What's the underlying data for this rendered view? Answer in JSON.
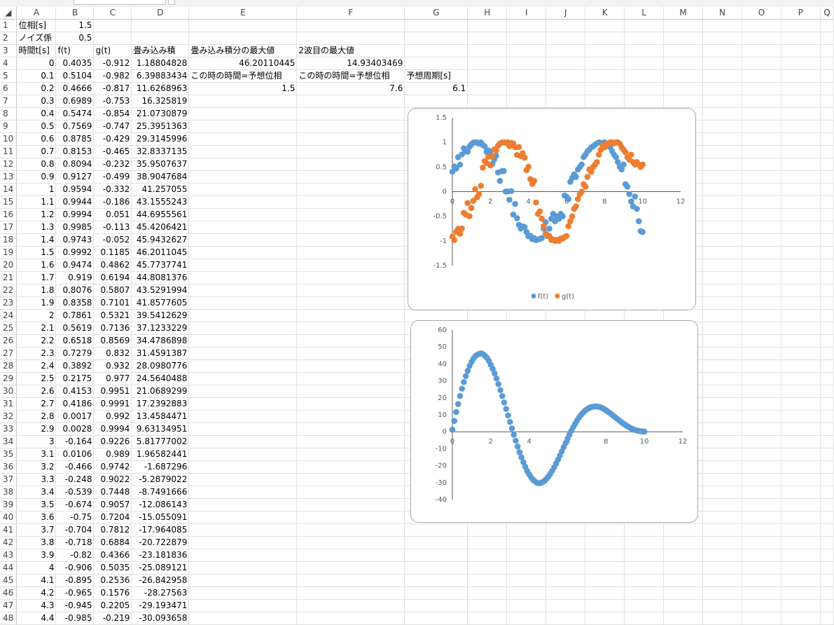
{
  "columns": [
    "A",
    "B",
    "C",
    "D",
    "E",
    "F",
    "G",
    "H",
    "I",
    "J",
    "K",
    "L",
    "M",
    "N",
    "O",
    "P",
    "Q"
  ],
  "rows": [
    {
      "r": "1",
      "A": "位相[s]",
      "B": "1.5"
    },
    {
      "r": "2",
      "A": "ノイズ係",
      "B": "0.5"
    },
    {
      "r": "3",
      "A": "時間t[s]",
      "B": "f(t)",
      "C": "g(t)",
      "D": "畳み込み積",
      "E": "畳み込み積分の最大値",
      "F": "2波目の最大値"
    },
    {
      "r": "4",
      "A": "0",
      "B": "0.4035",
      "C": "-0.912",
      "D": "1.18804828",
      "E": "46.20110445",
      "F": "14.93403469"
    },
    {
      "r": "5",
      "A": "0.1",
      "B": "0.5104",
      "C": "-0.982",
      "D": "6.39883434",
      "E": "この時の時間=予想位相",
      "F": "この時の時間=予想位相",
      "G": "予想周期[s]"
    },
    {
      "r": "6",
      "A": "0.2",
      "B": "0.4666",
      "C": "-0.817",
      "D": "11.6268963",
      "E": "1.5",
      "F": "7.6",
      "G": "6.1"
    },
    {
      "r": "7",
      "A": "0.3",
      "B": "0.6989",
      "C": "-0.753",
      "D": "16.325819"
    },
    {
      "r": "8",
      "A": "0.4",
      "B": "0.5474",
      "C": "-0.854",
      "D": "21.0730879"
    },
    {
      "r": "9",
      "A": "0.5",
      "B": "0.7569",
      "C": "-0.747",
      "D": "25.3951363"
    },
    {
      "r": "10",
      "A": "0.6",
      "B": "0.8785",
      "C": "-0.429",
      "D": "29.3145996"
    },
    {
      "r": "11",
      "A": "0.7",
      "B": "0.8153",
      "C": "-0.465",
      "D": "32.8337135"
    },
    {
      "r": "12",
      "A": "0.8",
      "B": "0.8094",
      "C": "-0.232",
      "D": "35.9507637"
    },
    {
      "r": "13",
      "A": "0.9",
      "B": "0.9127",
      "C": "-0.499",
      "D": "38.9047684"
    },
    {
      "r": "14",
      "A": "1",
      "B": "0.9594",
      "C": "-0.332",
      "D": "41.257055"
    },
    {
      "r": "15",
      "A": "1.1",
      "B": "0.9944",
      "C": "-0.186",
      "D": "43.1555243"
    },
    {
      "r": "16",
      "A": "1.2",
      "B": "0.9994",
      "C": "0.051",
      "D": "44.6955561"
    },
    {
      "r": "17",
      "A": "1.3",
      "B": "0.9985",
      "C": "-0.113",
      "D": "45.4206421"
    },
    {
      "r": "18",
      "A": "1.4",
      "B": "0.9743",
      "C": "-0.052",
      "D": "45.9432627"
    },
    {
      "r": "19",
      "A": "1.5",
      "B": "0.9992",
      "C": "0.1185",
      "D": "46.2011045"
    },
    {
      "r": "20",
      "A": "1.6",
      "B": "0.9474",
      "C": "0.4862",
      "D": "45.7737741"
    },
    {
      "r": "21",
      "A": "1.7",
      "B": "0.919",
      "C": "0.6194",
      "D": "44.8081376"
    },
    {
      "r": "22",
      "A": "1.8",
      "B": "0.8076",
      "C": "0.5807",
      "D": "43.5291994"
    },
    {
      "r": "23",
      "A": "1.9",
      "B": "0.8358",
      "C": "0.7101",
      "D": "41.8577605"
    },
    {
      "r": "24",
      "A": "2",
      "B": "0.7861",
      "C": "0.5321",
      "D": "39.5412629"
    },
    {
      "r": "25",
      "A": "2.1",
      "B": "0.5619",
      "C": "0.7136",
      "D": "37.1233229"
    },
    {
      "r": "26",
      "A": "2.2",
      "B": "0.6518",
      "C": "0.8569",
      "D": "34.4786898"
    },
    {
      "r": "27",
      "A": "2.3",
      "B": "0.7279",
      "C": "0.832",
      "D": "31.4591387"
    },
    {
      "r": "28",
      "A": "2.4",
      "B": "0.3892",
      "C": "0.932",
      "D": "28.0980776"
    },
    {
      "r": "29",
      "A": "2.5",
      "B": "0.2175",
      "C": "0.977",
      "D": "24.5640488"
    },
    {
      "r": "30",
      "A": "2.6",
      "B": "0.4153",
      "C": "0.9951",
      "D": "21.0689299"
    },
    {
      "r": "31",
      "A": "2.7",
      "B": "0.4186",
      "C": "0.9991",
      "D": "17.2392883"
    },
    {
      "r": "32",
      "A": "2.8",
      "B": "0.0017",
      "C": "0.992",
      "D": "13.4584471"
    },
    {
      "r": "33",
      "A": "2.9",
      "B": "0.0028",
      "C": "0.9994",
      "D": "9.63134951"
    },
    {
      "r": "34",
      "A": "3",
      "B": "-0.164",
      "C": "0.9226",
      "D": "5.81777002"
    },
    {
      "r": "35",
      "A": "3.1",
      "B": "0.0106",
      "C": "0.989",
      "D": "1.96582441"
    },
    {
      "r": "36",
      "A": "3.2",
      "B": "-0.466",
      "C": "0.9742",
      "D": "-1.687296"
    },
    {
      "r": "37",
      "A": "3.3",
      "B": "-0.248",
      "C": "0.9022",
      "D": "-5.2879022"
    },
    {
      "r": "38",
      "A": "3.4",
      "B": "-0.539",
      "C": "0.7448",
      "D": "-8.7491666"
    },
    {
      "r": "39",
      "A": "3.5",
      "B": "-0.674",
      "C": "0.9057",
      "D": "-12.086143"
    },
    {
      "r": "40",
      "A": "3.6",
      "B": "-0.75",
      "C": "0.7204",
      "D": "-15.055091"
    },
    {
      "r": "41",
      "A": "3.7",
      "B": "-0.704",
      "C": "0.7812",
      "D": "-17.964085"
    },
    {
      "r": "42",
      "A": "3.8",
      "B": "-0.718",
      "C": "0.6884",
      "D": "-20.722879"
    },
    {
      "r": "43",
      "A": "3.9",
      "B": "-0.82",
      "C": "0.4366",
      "D": "-23.181836"
    },
    {
      "r": "44",
      "A": "4",
      "B": "-0.906",
      "C": "0.5035",
      "D": "-25.089121"
    },
    {
      "r": "45",
      "A": "4.1",
      "B": "-0.895",
      "C": "0.2536",
      "D": "-26.842958"
    },
    {
      "r": "46",
      "A": "4.2",
      "B": "-0.965",
      "C": "0.1576",
      "D": "-28.27563"
    },
    {
      "r": "47",
      "A": "4.3",
      "B": "-0.945",
      "C": "0.2205",
      "D": "-29.193471"
    },
    {
      "r": "48",
      "A": "4.4",
      "B": "-0.985",
      "C": "-0.219",
      "D": "-30.093658"
    }
  ],
  "chart_data": [
    {
      "type": "scatter",
      "xlim": [
        0,
        12
      ],
      "ylim": [
        -1.5,
        1.5
      ],
      "xticks": [
        0,
        2,
        4,
        6,
        8,
        10,
        12
      ],
      "yticks": [
        -1.5,
        -1,
        -0.5,
        0,
        0.5,
        1,
        1.5
      ],
      "legend_position": "bottom",
      "series": [
        {
          "name": "f(t)",
          "color": "#5b9bd5",
          "x": [
            0,
            0.1,
            0.2,
            0.3,
            0.4,
            0.5,
            0.6,
            0.7,
            0.8,
            0.9,
            1,
            1.1,
            1.2,
            1.3,
            1.4,
            1.5,
            1.6,
            1.7,
            1.8,
            1.9,
            2,
            2.1,
            2.2,
            2.3,
            2.4,
            2.5,
            2.6,
            2.7,
            2.8,
            2.9,
            3,
            3.1,
            3.2,
            3.3,
            3.4,
            3.5,
            3.6,
            3.7,
            3.8,
            3.9,
            4,
            4.1,
            4.2,
            4.3,
            4.4,
            4.5,
            4.6,
            4.7,
            4.8,
            4.9,
            5,
            5.1,
            5.2,
            5.3,
            5.4,
            5.5,
            5.6,
            5.7,
            5.8,
            5.9,
            6,
            6.1,
            6.2,
            6.3,
            6.4,
            6.5,
            6.6,
            6.7,
            6.8,
            6.9,
            7,
            7.1,
            7.2,
            7.3,
            7.4,
            7.5,
            7.6,
            7.7,
            7.8,
            7.9,
            8,
            8.1,
            8.2,
            8.3,
            8.4,
            8.5,
            8.6,
            8.7,
            8.8,
            8.9,
            9,
            9.1,
            9.2,
            9.3,
            9.4,
            9.5,
            9.6,
            9.7,
            9.8,
            9.9,
            10
          ],
          "y": [
            0.4035,
            0.5104,
            0.4666,
            0.6989,
            0.5474,
            0.7569,
            0.8785,
            0.8153,
            0.8094,
            0.9127,
            0.9594,
            0.9944,
            0.9994,
            0.9985,
            0.9743,
            0.9992,
            0.9474,
            0.919,
            0.8076,
            0.8358,
            0.7861,
            0.5619,
            0.6518,
            0.7279,
            0.3892,
            0.2175,
            0.4153,
            0.4186,
            0.0017,
            0.0028,
            -0.164,
            0.0106,
            -0.466,
            -0.248,
            -0.539,
            -0.674,
            -0.75,
            -0.704,
            -0.718,
            -0.82,
            -0.906,
            -0.895,
            -0.965,
            -0.945,
            -0.985,
            -0.97,
            -0.96,
            -0.94,
            -0.75,
            -0.62,
            -0.9,
            -0.75,
            -0.55,
            -0.45,
            -0.6,
            -0.5,
            -0.55,
            -0.45,
            -0.5,
            -0.08,
            -0.1,
            -0.15,
            0.2,
            0.28,
            0.35,
            0.3,
            0.45,
            0.5,
            0.55,
            0.7,
            0.75,
            0.82,
            0.85,
            0.9,
            0.92,
            0.95,
            0.98,
            1.0,
            0.99,
            0.98,
            1.0,
            0.97,
            0.95,
            0.9,
            0.82,
            0.75,
            0.7,
            0.6,
            0.5,
            0.45,
            0.55,
            0.15,
            0.1,
            -0.05,
            -0.2,
            -0.3,
            -0.1,
            -0.35,
            -0.6,
            -0.8,
            -0.82
          ]
        },
        {
          "name": "g(t)",
          "color": "#ed7d31",
          "x": [
            0,
            0.1,
            0.2,
            0.3,
            0.4,
            0.5,
            0.6,
            0.7,
            0.8,
            0.9,
            1,
            1.1,
            1.2,
            1.3,
            1.4,
            1.5,
            1.6,
            1.7,
            1.8,
            1.9,
            2,
            2.1,
            2.2,
            2.3,
            2.4,
            2.5,
            2.6,
            2.7,
            2.8,
            2.9,
            3,
            3.1,
            3.2,
            3.3,
            3.4,
            3.5,
            3.6,
            3.7,
            3.8,
            3.9,
            4,
            4.1,
            4.2,
            4.3,
            4.4,
            4.5,
            4.6,
            4.7,
            4.8,
            4.9,
            5,
            5.1,
            5.2,
            5.3,
            5.4,
            5.5,
            5.6,
            5.7,
            5.8,
            5.9,
            6,
            6.1,
            6.2,
            6.3,
            6.4,
            6.5,
            6.6,
            6.7,
            6.8,
            6.9,
            7,
            7.1,
            7.2,
            7.3,
            7.4,
            7.5,
            7.6,
            7.7,
            7.8,
            7.9,
            8,
            8.1,
            8.2,
            8.3,
            8.4,
            8.5,
            8.6,
            8.7,
            8.8,
            8.9,
            9,
            9.1,
            9.2,
            9.3,
            9.4,
            9.5,
            9.6,
            9.7,
            9.8,
            9.9,
            10
          ],
          "y": [
            -0.912,
            -0.982,
            -0.817,
            -0.753,
            -0.854,
            -0.747,
            -0.429,
            -0.465,
            -0.232,
            -0.499,
            -0.332,
            -0.186,
            0.051,
            -0.113,
            -0.052,
            0.1185,
            0.4862,
            0.6194,
            0.5807,
            0.7101,
            0.5321,
            0.7136,
            0.8569,
            0.832,
            0.932,
            0.977,
            0.9951,
            0.9991,
            0.992,
            0.9994,
            0.9226,
            0.989,
            0.9742,
            0.9022,
            0.7448,
            0.9057,
            0.7204,
            0.7812,
            0.6884,
            0.4366,
            0.5035,
            0.2536,
            0.1576,
            0.2205,
            -0.219,
            -0.45,
            -0.4,
            -0.55,
            -0.7,
            -0.85,
            -0.88,
            -0.9,
            -0.98,
            -0.97,
            -1.0,
            -0.98,
            -1.0,
            -0.95,
            -0.95,
            -0.92,
            -0.9,
            -0.7,
            -0.6,
            -0.5,
            -0.35,
            -0.3,
            -0.15,
            -0.05,
            0.0,
            0.15,
            0.1,
            0.3,
            0.45,
            0.4,
            0.5,
            0.55,
            0.6,
            0.75,
            0.85,
            0.95,
            0.9,
            0.95,
            0.98,
            1.0,
            1.0,
            0.98,
            1.0,
            1.0,
            0.97,
            0.9,
            0.85,
            0.8,
            0.7,
            0.65,
            0.75,
            0.6,
            0.55,
            0.6,
            0.55,
            0.5,
            0.55
          ]
        }
      ]
    },
    {
      "type": "scatter",
      "xlim": [
        0,
        12
      ],
      "ylim": [
        -40,
        60
      ],
      "xticks": [
        0,
        2,
        4,
        6,
        8,
        10,
        12
      ],
      "yticks": [
        -40,
        -30,
        -20,
        -10,
        0,
        10,
        20,
        30,
        40,
        50,
        60
      ],
      "series": [
        {
          "name": "",
          "color": "#5b9bd5",
          "x": [
            0,
            0.1,
            0.2,
            0.3,
            0.4,
            0.5,
            0.6,
            0.7,
            0.8,
            0.9,
            1,
            1.1,
            1.2,
            1.3,
            1.4,
            1.5,
            1.6,
            1.7,
            1.8,
            1.9,
            2,
            2.1,
            2.2,
            2.3,
            2.4,
            2.5,
            2.6,
            2.7,
            2.8,
            2.9,
            3,
            3.1,
            3.2,
            3.3,
            3.4,
            3.5,
            3.6,
            3.7,
            3.8,
            3.9,
            4,
            4.1,
            4.2,
            4.3,
            4.4,
            4.5,
            4.6,
            4.7,
            4.8,
            4.9,
            5,
            5.1,
            5.2,
            5.3,
            5.4,
            5.5,
            5.6,
            5.7,
            5.8,
            5.9,
            6,
            6.1,
            6.2,
            6.3,
            6.4,
            6.5,
            6.6,
            6.7,
            6.8,
            6.9,
            7,
            7.1,
            7.2,
            7.3,
            7.4,
            7.5,
            7.6,
            7.7,
            7.8,
            7.9,
            8,
            8.1,
            8.2,
            8.3,
            8.4,
            8.5,
            8.6,
            8.7,
            8.8,
            8.9,
            9,
            9.1,
            9.2,
            9.3,
            9.4,
            9.5,
            9.6,
            9.7,
            9.8,
            9.9,
            10
          ],
          "y": [
            1.188,
            6.399,
            11.627,
            16.326,
            21.073,
            25.395,
            29.315,
            32.834,
            35.951,
            38.905,
            41.257,
            43.156,
            44.696,
            45.421,
            45.943,
            46.201,
            45.774,
            44.808,
            43.529,
            41.858,
            39.541,
            37.123,
            34.479,
            31.459,
            28.098,
            24.564,
            21.069,
            17.239,
            13.458,
            9.631,
            5.818,
            1.966,
            -1.687,
            -5.288,
            -8.749,
            -12.086,
            -15.055,
            -17.964,
            -20.723,
            -23.182,
            -25.089,
            -26.843,
            -28.276,
            -29.193,
            -30.094,
            -30.3,
            -30.2,
            -29.7,
            -28.9,
            -27.8,
            -26.4,
            -24.8,
            -23.0,
            -21.0,
            -18.8,
            -16.5,
            -14.1,
            -11.6,
            -9.1,
            -6.6,
            -4.1,
            -1.7,
            0.6,
            2.8,
            4.8,
            6.7,
            8.4,
            9.9,
            11.2,
            12.3,
            13.2,
            13.9,
            14.4,
            14.8,
            14.9,
            14.93,
            14.8,
            14.5,
            14.0,
            13.4,
            12.7,
            11.9,
            11.1,
            10.2,
            9.3,
            8.4,
            7.5,
            6.6,
            5.7,
            4.9,
            4.1,
            3.4,
            2.7,
            2.1,
            1.6,
            1.1,
            0.8,
            0.5,
            0.3,
            0.2,
            0.1
          ]
        }
      ]
    }
  ]
}
